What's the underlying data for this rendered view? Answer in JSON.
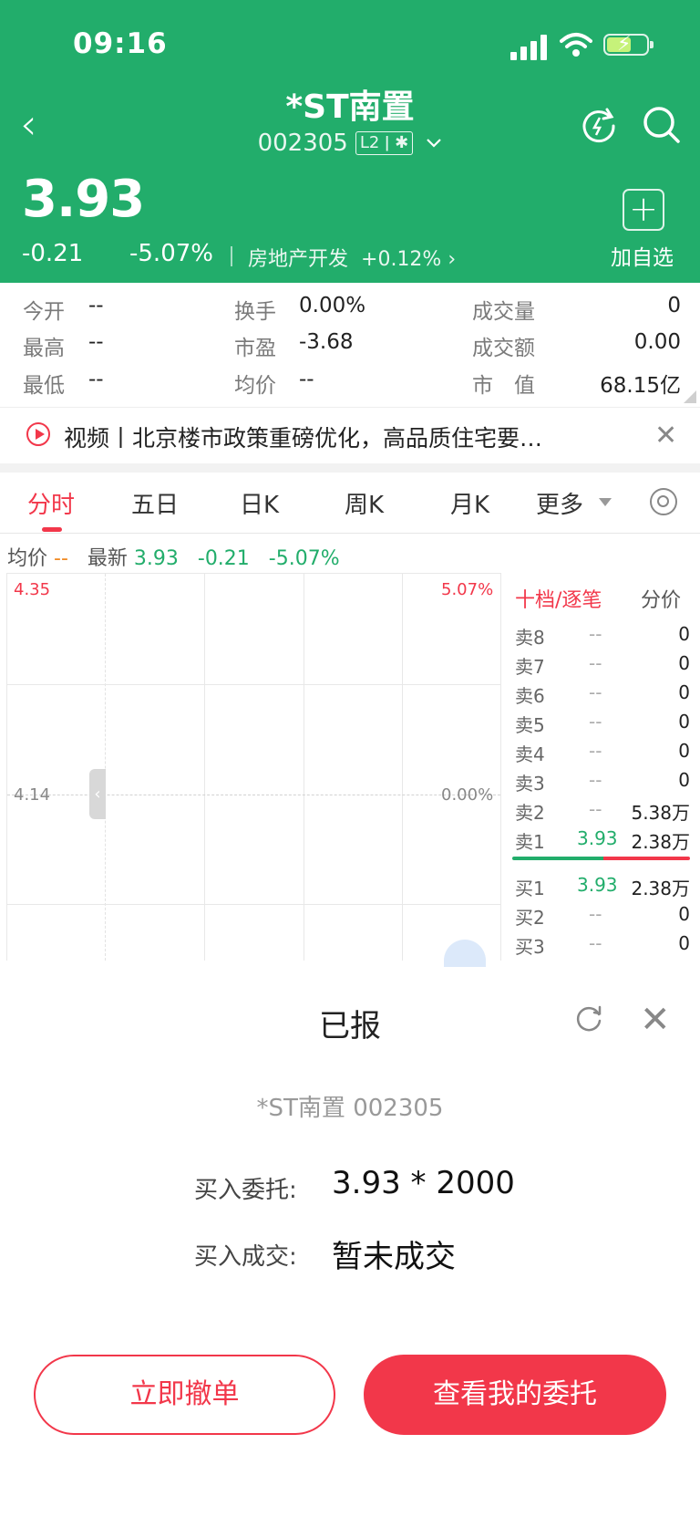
{
  "status_bar": {
    "time": "09:16"
  },
  "header": {
    "stock_name": "*ST南置",
    "stock_code": "002305",
    "level_badge": "L2",
    "price": "3.93",
    "change": "-0.21",
    "change_pct": "-5.07%",
    "sector": "房地产开发",
    "sector_change": "+0.12%",
    "add_watchlist_label": "加自选",
    "colors": {
      "header_bg": "#22ad6b"
    }
  },
  "quote": {
    "open_label": "今开",
    "open_value": "--",
    "turnover_label": "换手",
    "turnover_value": "0.00%",
    "volume_label": "成交量",
    "volume_value": "0",
    "high_label": "最高",
    "high_value": "--",
    "pe_label": "市盈",
    "pe_value": "-3.68",
    "amount_label": "成交额",
    "amount_value": "0.00",
    "low_label": "最低",
    "low_value": "--",
    "avg_label": "均价",
    "avg_value": "--",
    "mktcap_label": "市　值",
    "mktcap_value": "68.15亿"
  },
  "news": {
    "text": "视频丨北京楼市政策重磅优化，高品质住宅要…"
  },
  "tabs": [
    {
      "label": "分时",
      "active": true
    },
    {
      "label": "五日"
    },
    {
      "label": "日K"
    },
    {
      "label": "周K"
    },
    {
      "label": "月K"
    },
    {
      "label": "更多"
    }
  ],
  "info_line": {
    "avg_label": "均价",
    "avg_value": "--",
    "latest_label": "最新",
    "latest_value": "3.93",
    "change": "-0.21",
    "change_pct": "-5.07%"
  },
  "chart": {
    "y_high": "4.35",
    "y_mid": "4.14",
    "pct_high": "5.07%",
    "pct_mid": "0.00%"
  },
  "order_book": {
    "title": "十档/逐笔",
    "side_tab": "分价",
    "asks": [
      {
        "label": "卖8",
        "price": "--",
        "vol": "0"
      },
      {
        "label": "卖7",
        "price": "--",
        "vol": "0"
      },
      {
        "label": "卖6",
        "price": "--",
        "vol": "0"
      },
      {
        "label": "卖5",
        "price": "--",
        "vol": "0"
      },
      {
        "label": "卖4",
        "price": "--",
        "vol": "0"
      },
      {
        "label": "卖3",
        "price": "--",
        "vol": "0"
      },
      {
        "label": "卖2",
        "price": "--",
        "vol": "5.38万"
      },
      {
        "label": "卖1",
        "price": "3.93",
        "vol": "2.38万"
      }
    ],
    "bids": [
      {
        "label": "买1",
        "price": "3.93",
        "vol": "2.38万"
      },
      {
        "label": "买2",
        "price": "--",
        "vol": "0"
      },
      {
        "label": "买3",
        "price": "--",
        "vol": "0"
      }
    ]
  },
  "dialog": {
    "title": "已报",
    "stock": "*ST南置 002305",
    "order_label": "买入委托:",
    "order_value": "3.93 * 2000",
    "fill_label": "买入成交:",
    "fill_value": "暂未成交",
    "cancel_button": "立即撤单",
    "view_button": "查看我的委托",
    "colors": {
      "accent": "#f2374a"
    }
  }
}
